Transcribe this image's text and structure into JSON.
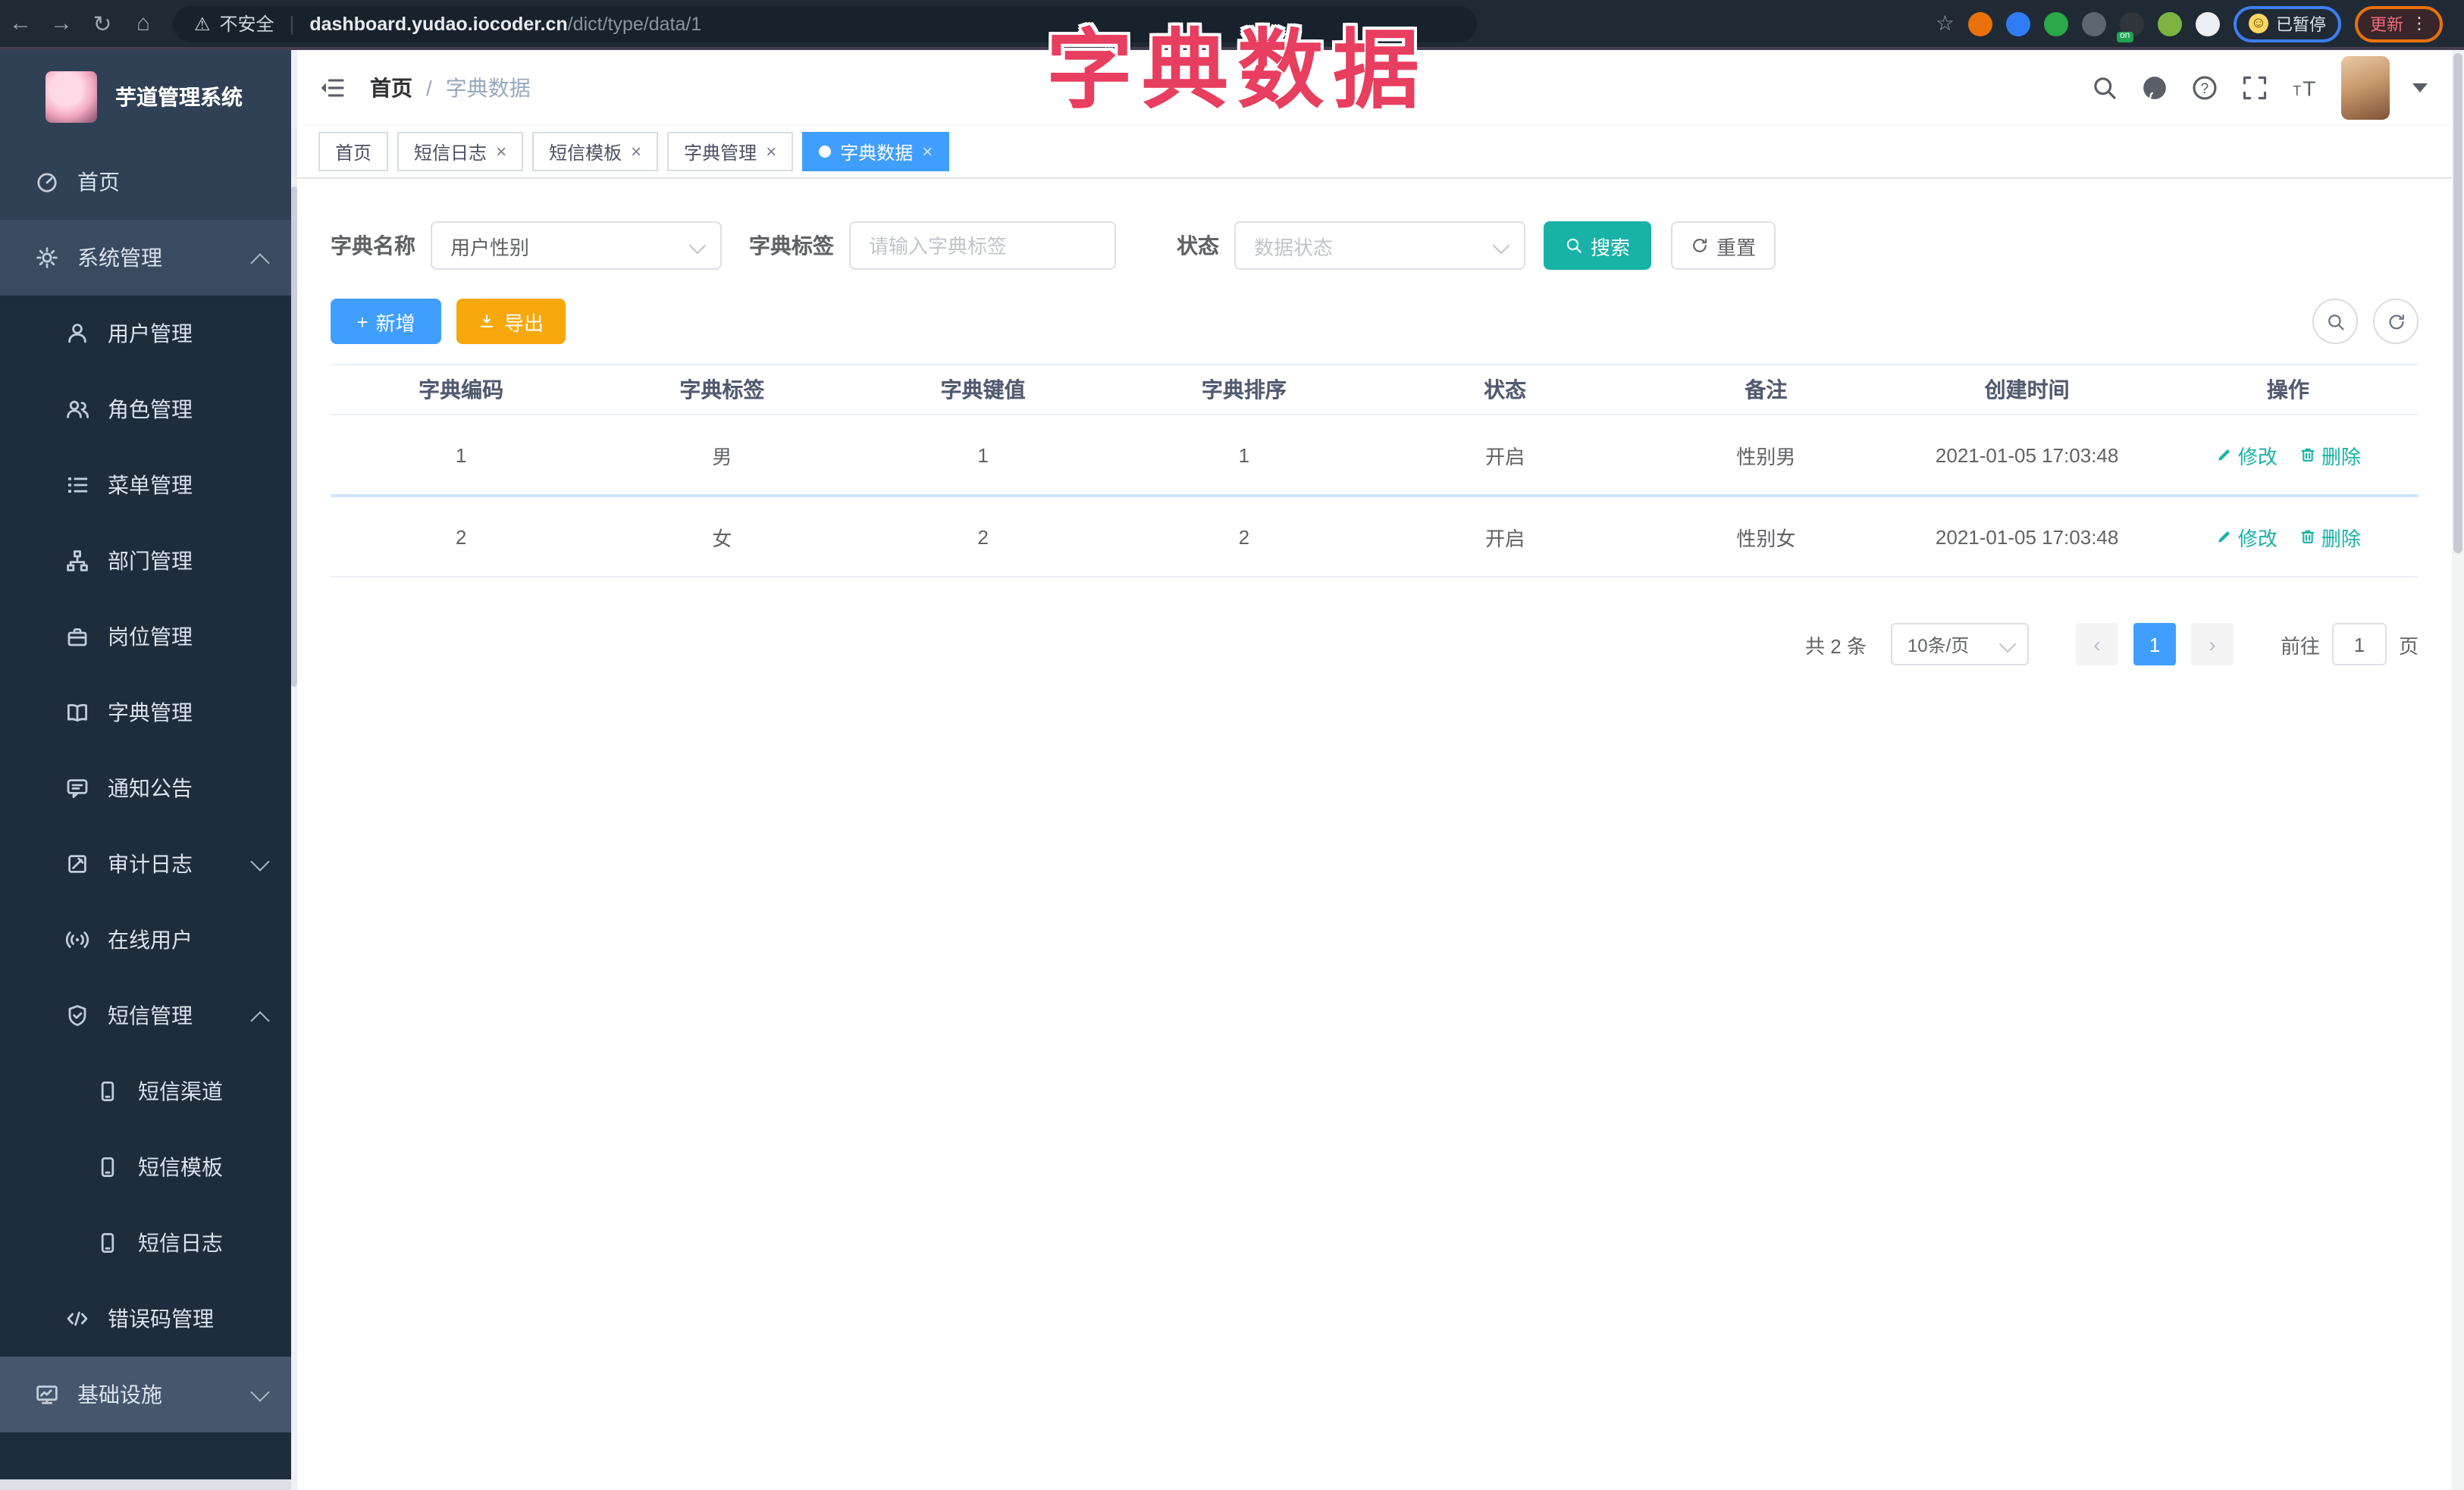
{
  "browser": {
    "nav_icons": [
      "back-arrow-icon",
      "forward-arrow-icon",
      "reload-icon",
      "home-icon"
    ],
    "security_label": "不安全",
    "url_host": "dashboard.yudao.iocoder.cn",
    "url_path": "/dict/type/data/1",
    "extensions": [
      {
        "name": "orange-ring-extension-icon",
        "color": "#e8710a"
      },
      {
        "name": "blue-gem-extension-icon",
        "color": "#2f7cf6"
      },
      {
        "name": "green-check-extension-icon",
        "color": "#2aa84a"
      },
      {
        "name": "sliders-extension-icon",
        "color": "#5c6570"
      },
      {
        "name": "dark-on-extension-icon",
        "color": "#30353b",
        "badge": "on"
      },
      {
        "name": "green-leaf-extension-icon",
        "color": "#7cb342"
      },
      {
        "name": "puzzle-extension-icon",
        "color": "#eceff1"
      }
    ],
    "paused_badge": "已暂停",
    "update_label": "更新"
  },
  "overlay_title": "字典数据",
  "sidebar": {
    "logo_title": "芋道管理系统",
    "items": [
      {
        "icon": "dashboard-icon",
        "label": "首页",
        "level": 0
      },
      {
        "icon": "gear-icon",
        "label": "系统管理",
        "level": 0,
        "chevron": "up",
        "bg": "#3a4a61"
      },
      {
        "icon": "user-icon",
        "label": "用户管理",
        "level": 1
      },
      {
        "icon": "users-icon",
        "label": "角色管理",
        "level": 1
      },
      {
        "icon": "menu-list-icon",
        "label": "菜单管理",
        "level": 1
      },
      {
        "icon": "org-tree-icon",
        "label": "部门管理",
        "level": 1
      },
      {
        "icon": "briefcase-icon",
        "label": "岗位管理",
        "level": 1
      },
      {
        "icon": "book-icon",
        "label": "字典管理",
        "level": 1
      },
      {
        "icon": "megaphone-icon",
        "label": "通知公告",
        "level": 1
      },
      {
        "icon": "audit-log-icon",
        "label": "审计日志",
        "level": 1,
        "chevron": "down"
      },
      {
        "icon": "online-icon",
        "label": "在线用户",
        "level": 1
      },
      {
        "icon": "shield-icon",
        "label": "短信管理",
        "level": 1,
        "chevron": "up"
      },
      {
        "icon": "phone-icon",
        "label": "短信渠道",
        "level": 2
      },
      {
        "icon": "phone-icon",
        "label": "短信模板",
        "level": 2
      },
      {
        "icon": "phone-icon",
        "label": "短信日志",
        "level": 2
      },
      {
        "icon": "code-icon",
        "label": "错误码管理",
        "level": 1
      },
      {
        "icon": "monitor-icon",
        "label": "基础设施",
        "level": 0,
        "chevron": "down",
        "bg": "#46566d"
      }
    ]
  },
  "navbar": {
    "breadcrumb_home": "首页",
    "breadcrumb_sep": "/",
    "breadcrumb_current": "字典数据",
    "right_icons": [
      "search-icon",
      "github-icon",
      "question-icon",
      "fullscreen-icon",
      "font-size-icon"
    ]
  },
  "tabs": [
    {
      "label": "首页",
      "closable": false,
      "active": false
    },
    {
      "label": "短信日志",
      "closable": true,
      "active": false
    },
    {
      "label": "短信模板",
      "closable": true,
      "active": false
    },
    {
      "label": "字典管理",
      "closable": true,
      "active": false
    },
    {
      "label": "字典数据",
      "closable": true,
      "active": true
    }
  ],
  "filters": {
    "dict_name_label": "字典名称",
    "dict_name_value": "用户性别",
    "dict_label_label": "字典标签",
    "dict_label_placeholder": "请输入字典标签",
    "status_label": "状态",
    "status_placeholder": "数据状态",
    "search_label": "搜索",
    "reset_label": "重置"
  },
  "toolbar": {
    "add_label": "新增",
    "export_label": "导出"
  },
  "table": {
    "columns": [
      "字典编码",
      "字典标签",
      "字典键值",
      "字典排序",
      "状态",
      "备注",
      "创建时间",
      "操作"
    ],
    "rows": [
      {
        "cells": [
          "1",
          "男",
          "1",
          "1",
          "开启",
          "性别男",
          "2021-01-05 17:03:48"
        ],
        "actions": [
          "修改",
          "删除"
        ]
      },
      {
        "cells": [
          "2",
          "女",
          "2",
          "2",
          "开启",
          "性别女",
          "2021-01-05 17:03:48"
        ],
        "actions": [
          "修改",
          "删除"
        ]
      }
    ]
  },
  "pagination": {
    "total_text": "共 2 条",
    "page_size": "10条/页",
    "prev_icon": "chevron-left-icon",
    "current_page": "1",
    "next_icon": "chevron-right-icon",
    "goto_label": "前往",
    "goto_value": "1",
    "unit_label": "页"
  },
  "colors": {
    "primary": "#409eff",
    "teal": "#18b2a6",
    "warning": "#f7a80d",
    "sidebar_bg": "#304156",
    "submenu_bg": "#1f2c3c",
    "browser_bar_bg": "#1f2a35",
    "tab_active_bg": "#409eff",
    "overlay_title_color": "#e83e5f",
    "link_color": "#18b2a6"
  }
}
